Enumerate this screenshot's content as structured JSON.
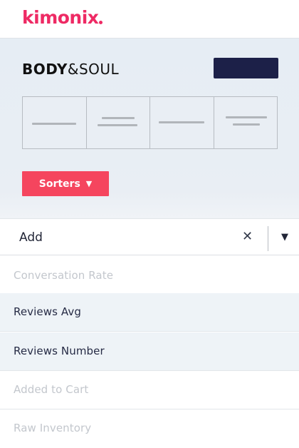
{
  "header": {
    "logo_text": "kimoni",
    "logo_x": "x"
  },
  "panel": {
    "brand_bold": "BODY",
    "brand_amp": "&",
    "brand_light": "SOUL",
    "sorters_label": "Sorters",
    "sorters_caret": "▼"
  },
  "select": {
    "value": "Add",
    "clear_glyph": "✕",
    "caret_glyph": "▼"
  },
  "options": [
    {
      "label": "Conversation Rate",
      "disabled": true
    },
    {
      "label": "Reviews Avg",
      "disabled": false
    },
    {
      "label": "Reviews Number",
      "disabled": false
    },
    {
      "label": "Added to Cart",
      "disabled": true
    },
    {
      "label": "Raw Inventory",
      "disabled": true
    }
  ],
  "colors": {
    "brand_pink": "#ee2a64",
    "sorters_red": "#f5455e",
    "navy": "#1c2048"
  }
}
